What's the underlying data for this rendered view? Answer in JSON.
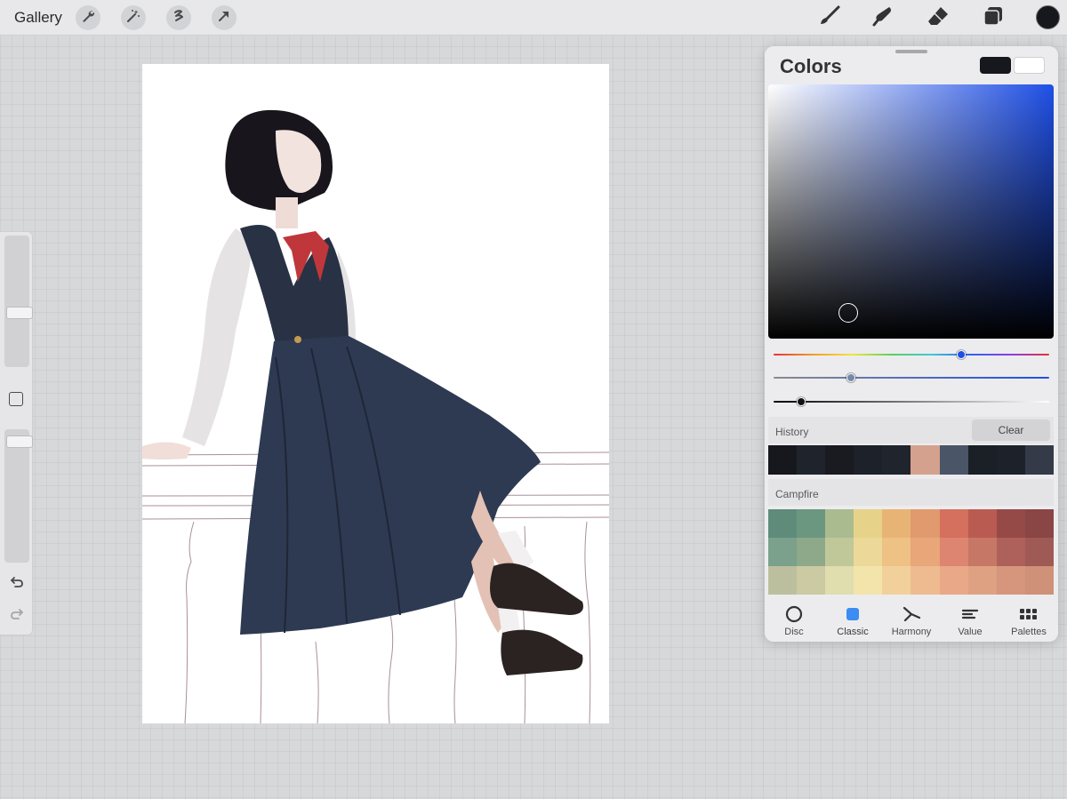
{
  "topbar": {
    "gallery_label": "Gallery",
    "left_tools": [
      "wrench-icon",
      "magic-wand-icon",
      "selection-icon",
      "transform-arrow-icon"
    ],
    "right_tools": [
      "brush-icon",
      "smudge-icon",
      "eraser-icon",
      "layers-icon"
    ],
    "current_color": "#16181d"
  },
  "sidebar": {
    "brush_size_level": 0.4,
    "opacity_level": 0.95
  },
  "colors_panel": {
    "title": "Colors",
    "primary_color": "#16181d",
    "secondary_color": "#ffffff",
    "hue_color": "#1f4fe6",
    "history_label": "History",
    "clear_label": "Clear",
    "history_colors": [
      "#16181d",
      "#1f232b",
      "#191b20",
      "#1d2129",
      "#20242c",
      "#d4a18f",
      "#4a5567",
      "#1b1f26",
      "#1d2129",
      "#343a47"
    ],
    "palette_name": "Campfire",
    "palette_colors": [
      "#5f8b7b",
      "#6b9680",
      "#aabb90",
      "#e6d389",
      "#e8b475",
      "#e19a6d",
      "#d4705d",
      "#ba5b52",
      "#954a47",
      "#8a4644",
      "#7ba08c",
      "#8ea88a",
      "#c0c89a",
      "#ecd999",
      "#eec184",
      "#e8a679",
      "#dd8570",
      "#c77766",
      "#ae605a",
      "#a05a55",
      "#bcbf9e",
      "#cccaa2",
      "#e0ddae",
      "#f3e4ab",
      "#f2d09b",
      "#eebb91",
      "#e9a887",
      "#dea283",
      "#d5967d",
      "#cf9178"
    ],
    "tabs": [
      {
        "label": "Disc",
        "icon": "disc-icon"
      },
      {
        "label": "Classic",
        "icon": "classic-icon"
      },
      {
        "label": "Harmony",
        "icon": "harmony-icon"
      },
      {
        "label": "Value",
        "icon": "value-icon"
      },
      {
        "label": "Palettes",
        "icon": "palettes-icon"
      }
    ],
    "active_tab": "Classic",
    "hue_level": 0.68,
    "saturation_level": 0.28,
    "brightness_level": 0.1,
    "accent": "#3c8cf2"
  }
}
